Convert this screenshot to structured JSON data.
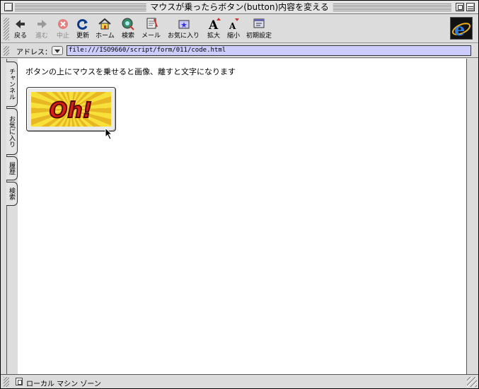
{
  "window": {
    "title": "マウスが乗ったらボタン(button)内容を変える"
  },
  "toolbar": {
    "back": "戻る",
    "forward": "進む",
    "stop": "中止",
    "reload": "更新",
    "home": "ホーム",
    "search": "検索",
    "mail": "メール",
    "favorites": "お気に入り",
    "larger": "拡大",
    "smaller": "縮小",
    "preferences": "初期設定",
    "forward_disabled": true,
    "stop_disabled": true
  },
  "address": {
    "label": "アドレス：",
    "url": "file:///ISO9660/script/form/011/code.html"
  },
  "sidebar": {
    "tabs": [
      "チャンネル",
      "お気に入り",
      "履歴",
      "検索"
    ]
  },
  "content": {
    "message": "ボタンの上にマウスを乗せると画像、離すと文字になります",
    "button_image_text": "Oh!"
  },
  "status": {
    "text": "ローカル マシン ゾーン"
  },
  "colors": {
    "address_field_bg": "#ccccff",
    "image_yellow": "#f7e03a",
    "image_text": "#d8201a"
  }
}
